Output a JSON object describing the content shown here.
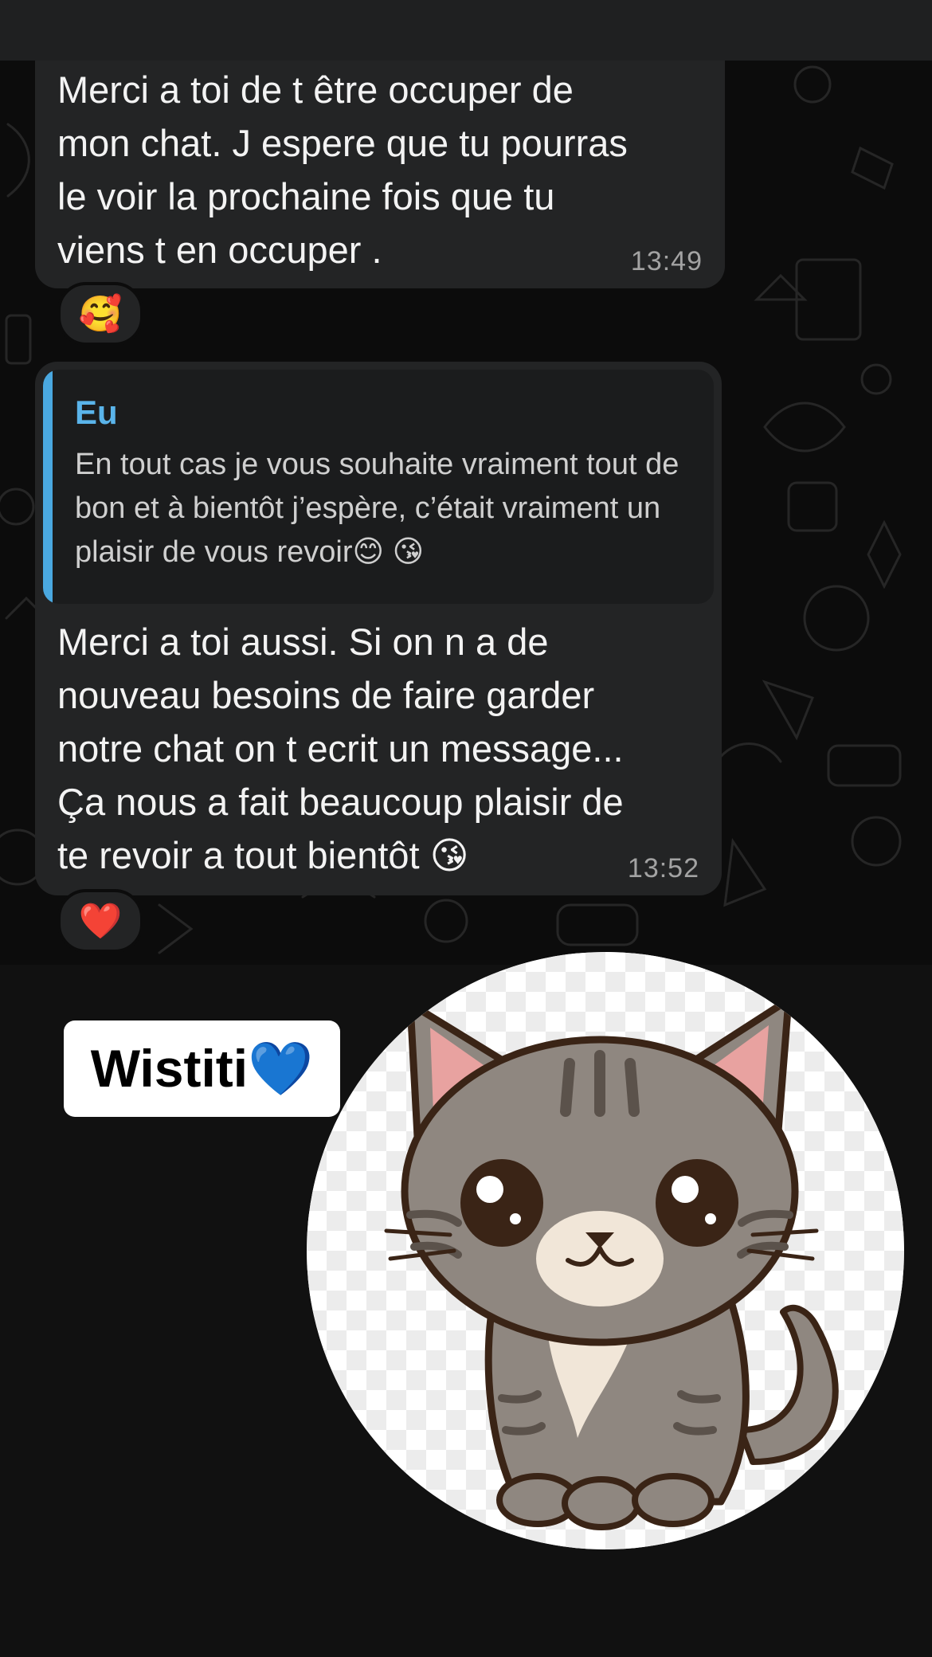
{
  "messages": [
    {
      "text": "Merci a toi de t être occuper de\nmon chat. J espere que tu pourras\nle voir la prochaine fois que tu\nviens t en occuper .",
      "time": "13:49",
      "reaction": "🥰"
    },
    {
      "quote": {
        "author": "Eu",
        "text": "En tout cas je vous souhaite vraiment tout de bon et à bientôt j’espère, c’était vraiment un plaisir de vous revoir😊 😘"
      },
      "text": "Merci a toi aussi. Si on n a de\nnouveau besoins de faire garder\nnotre chat on t ecrit un message...\nÇa nous a fait beaucoup plaisir de\nte revoir a tout bientôt 😘",
      "time": "13:52",
      "reaction": "❤️"
    }
  ],
  "contact": {
    "name": "Wistiti💙",
    "avatar_icon": "cartoon-cat-icon"
  },
  "colors": {
    "bubble": "#232425",
    "quote_accent": "#4aa8e0",
    "background": "#111111"
  }
}
